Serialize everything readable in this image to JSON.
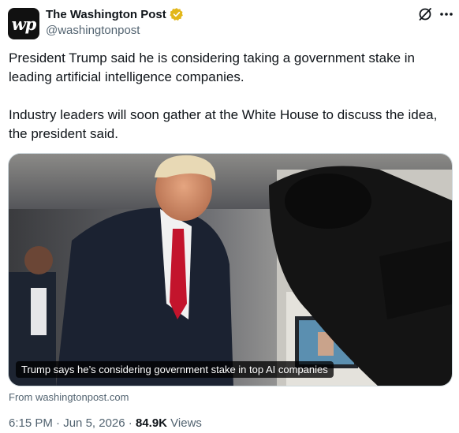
{
  "account": {
    "display_name": "The Washington Post",
    "handle": "@washingtonpost",
    "avatar_text": "wp",
    "verified_color": "#e2b719"
  },
  "tweet": {
    "paragraphs": [
      "President Trump said he is considering taking a government stake in leading artificial intelligence companies.",
      "Industry leaders will soon gather at the White House to discuss the idea, the president said."
    ],
    "media_caption": "Trump says he’s considering government stake in top AI companies",
    "source": "From washingtonpost.com",
    "time": "6:15 PM",
    "separator": "·",
    "date": "Jun 5, 2026",
    "views_count": "84.9K",
    "views_label": "Views"
  },
  "icons": {
    "grok": "grok-icon",
    "more": "more-icon",
    "verified": "verified-badge-icon"
  }
}
